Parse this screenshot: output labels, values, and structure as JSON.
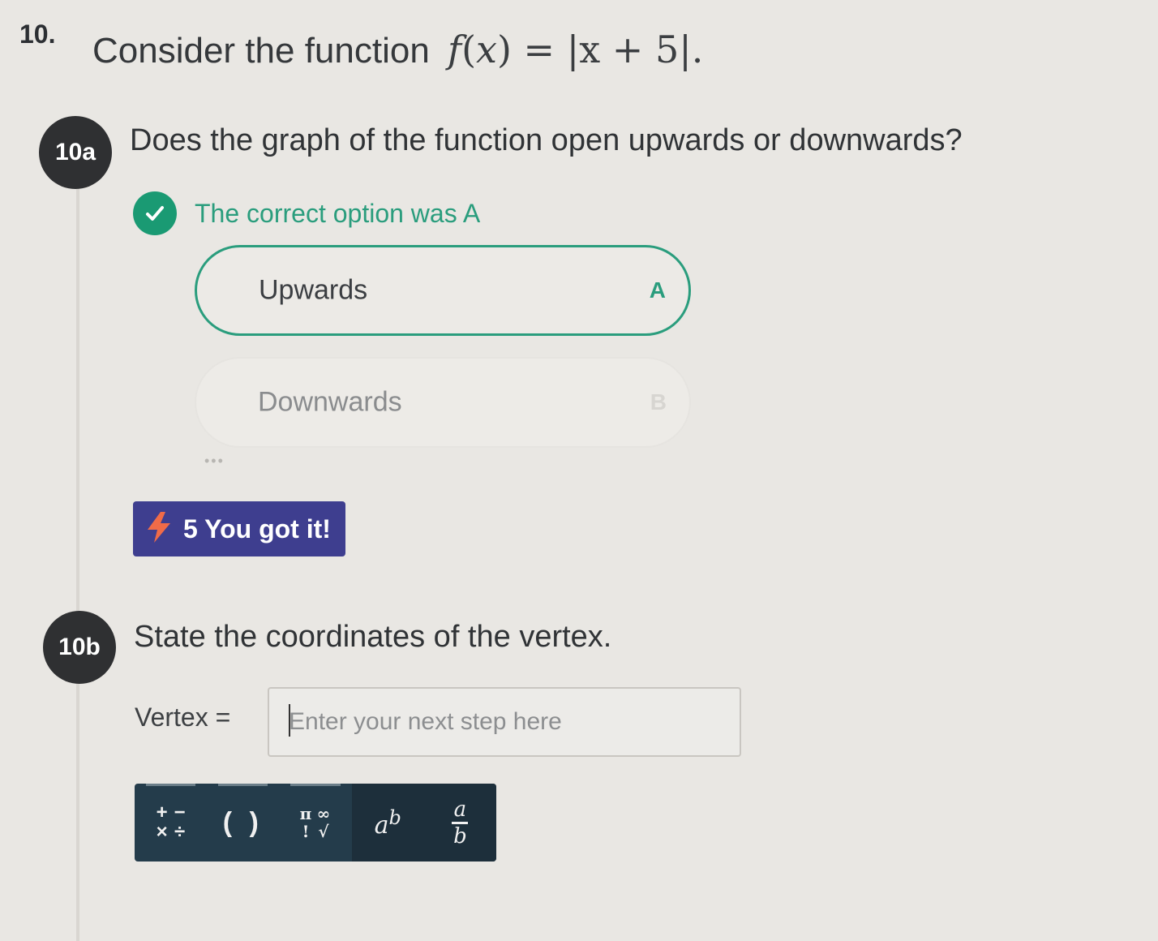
{
  "question": {
    "number": "10.",
    "prompt": "Consider the function",
    "function": {
      "name": "f",
      "variable": "x",
      "expression": "|x + 5|",
      "suffix": "."
    }
  },
  "part_a": {
    "badge": "10a",
    "question": "Does the graph of the function open upwards or downwards?",
    "feedback": "The correct option was A",
    "options": [
      {
        "label": "Upwards",
        "key": "A",
        "state": "correct"
      },
      {
        "label": "Downwards",
        "key": "B",
        "state": "faded"
      }
    ],
    "more_indicator": "•••",
    "points": {
      "value": "5",
      "message": "You got it!",
      "text": "5 You got it!"
    }
  },
  "part_b": {
    "badge": "10b",
    "question": "State the coordinates of the vertex.",
    "input_label": "Vertex =",
    "input_value": "",
    "input_placeholder": "Enter your next step here"
  },
  "math_toolbar": {
    "buttons": [
      {
        "name": "operators",
        "icon": "plus-minus-times-divide-icon",
        "glyphs": [
          "+",
          "−",
          "×",
          "÷"
        ]
      },
      {
        "name": "parentheses",
        "icon": "parentheses-icon",
        "glyph": "( )"
      },
      {
        "name": "symbols",
        "icon": "pi-infinity-factorial-root-icon",
        "glyphs": [
          "π",
          "∞",
          "!",
          "√"
        ]
      },
      {
        "name": "exponent",
        "icon": "exponent-icon",
        "base": "a",
        "power": "b"
      },
      {
        "name": "fraction",
        "icon": "fraction-icon",
        "numerator": "a",
        "denominator": "b"
      }
    ]
  },
  "colors": {
    "correct_green": "#2a9d7d",
    "badge_dark": "#2f3032",
    "points_purple": "#3e3e8f",
    "toolbar_navy": "#243c4b"
  }
}
